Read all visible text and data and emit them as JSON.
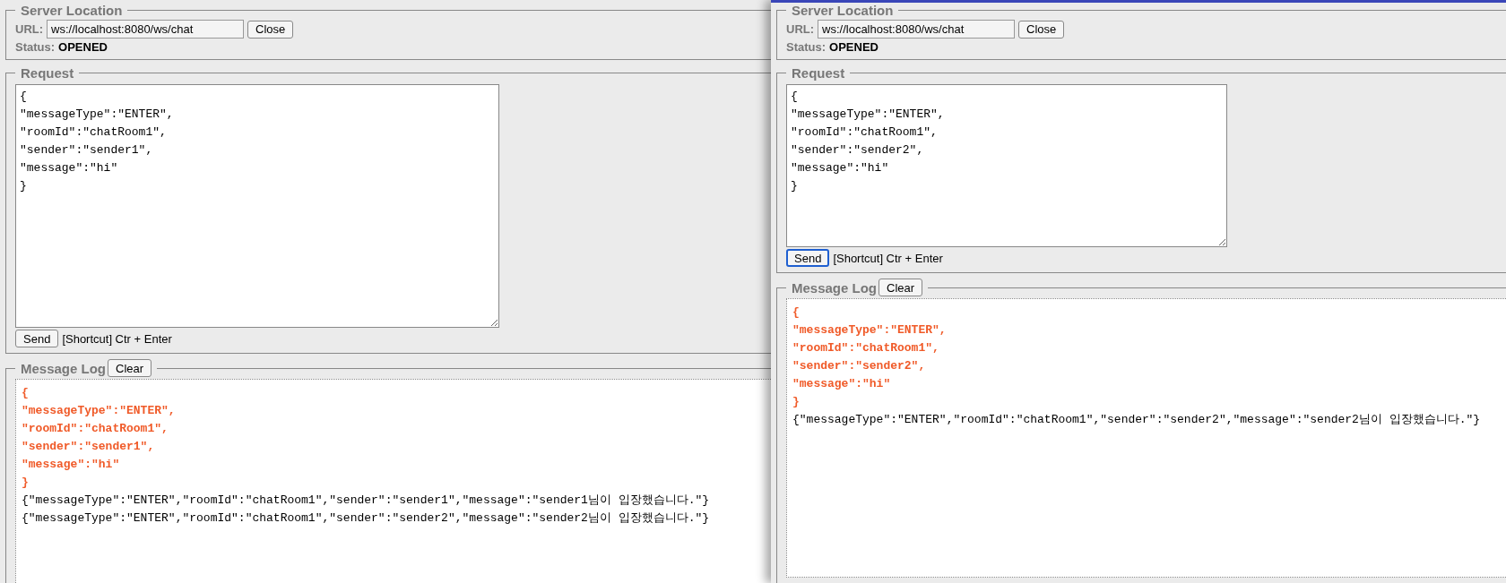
{
  "windows": [
    {
      "focused": false,
      "server_location": {
        "legend": "Server Location",
        "url_label": "URL:",
        "url": "ws://localhost:8080/ws/chat",
        "close_button": "Close",
        "status_label": "Status:",
        "status": "OPENED"
      },
      "request": {
        "legend": "Request",
        "body": "{\n\"messageType\":\"ENTER\",\n\"roomId\":\"chatRoom1\",\n\"sender\":\"sender1\",\n\"message\":\"hi\"\n}",
        "send_button": {
          "label": "Send",
          "focused": false
        },
        "shortcut": "[Shortcut] Ctr + Enter"
      },
      "message_log": {
        "legend": "Message Log",
        "clear_button": "Clear",
        "entries": [
          {
            "kind": "sent",
            "text": "{\n\"messageType\":\"ENTER\",\n\"roomId\":\"chatRoom1\",\n\"sender\":\"sender1\",\n\"message\":\"hi\"\n}"
          },
          {
            "kind": "received",
            "text": "{\"messageType\":\"ENTER\",\"roomId\":\"chatRoom1\",\"sender\":\"sender1\",\"message\":\"sender1님이 입장했습니다.\"}"
          },
          {
            "kind": "received",
            "text": "{\"messageType\":\"ENTER\",\"roomId\":\"chatRoom1\",\"sender\":\"sender2\",\"message\":\"sender2님이 입장했습니다.\"}"
          }
        ]
      }
    },
    {
      "focused": true,
      "server_location": {
        "legend": "Server Location",
        "url_label": "URL:",
        "url": "ws://localhost:8080/ws/chat",
        "close_button": "Close",
        "status_label": "Status:",
        "status": "OPENED"
      },
      "request": {
        "legend": "Request",
        "body": "{\n\"messageType\":\"ENTER\",\n\"roomId\":\"chatRoom1\",\n\"sender\":\"sender2\",\n\"message\":\"hi\"\n}",
        "send_button": {
          "label": "Send",
          "focused": true
        },
        "shortcut": "[Shortcut] Ctr + Enter"
      },
      "message_log": {
        "legend": "Message Log",
        "clear_button": "Clear",
        "entries": [
          {
            "kind": "sent",
            "text": "{\n\"messageType\":\"ENTER\",\n\"roomId\":\"chatRoom1\",\n\"sender\":\"sender2\",\n\"message\":\"hi\"\n}"
          },
          {
            "kind": "received",
            "text": "{\"messageType\":\"ENTER\",\"roomId\":\"chatRoom1\",\"sender\":\"sender2\",\"message\":\"sender2님이 입장했습니다.\"}"
          }
        ]
      }
    }
  ]
}
